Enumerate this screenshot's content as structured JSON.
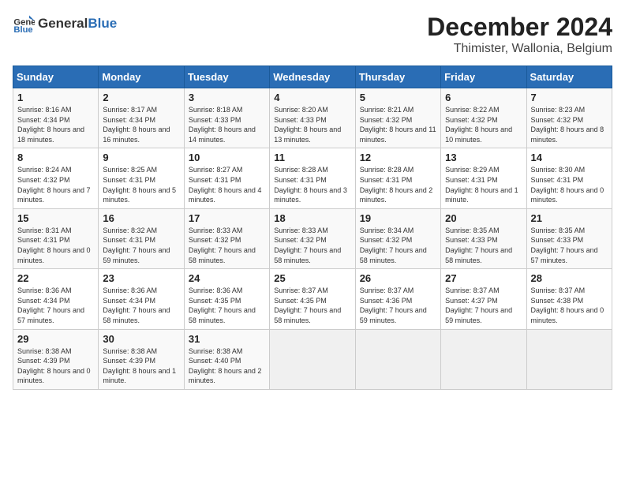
{
  "header": {
    "logo_general": "General",
    "logo_blue": "Blue",
    "title": "December 2024",
    "subtitle": "Thimister, Wallonia, Belgium"
  },
  "calendar": {
    "days_of_week": [
      "Sunday",
      "Monday",
      "Tuesday",
      "Wednesday",
      "Thursday",
      "Friday",
      "Saturday"
    ],
    "weeks": [
      [
        {
          "day": "",
          "info": ""
        },
        {
          "day": "2",
          "info": "Sunrise: 8:17 AM\nSunset: 4:34 PM\nDaylight: 8 hours and 16 minutes."
        },
        {
          "day": "3",
          "info": "Sunrise: 8:18 AM\nSunset: 4:33 PM\nDaylight: 8 hours and 14 minutes."
        },
        {
          "day": "4",
          "info": "Sunrise: 8:20 AM\nSunset: 4:33 PM\nDaylight: 8 hours and 13 minutes."
        },
        {
          "day": "5",
          "info": "Sunrise: 8:21 AM\nSunset: 4:32 PM\nDaylight: 8 hours and 11 minutes."
        },
        {
          "day": "6",
          "info": "Sunrise: 8:22 AM\nSunset: 4:32 PM\nDaylight: 8 hours and 10 minutes."
        },
        {
          "day": "7",
          "info": "Sunrise: 8:23 AM\nSunset: 4:32 PM\nDaylight: 8 hours and 8 minutes."
        }
      ],
      [
        {
          "day": "1",
          "info": "Sunrise: 8:16 AM\nSunset: 4:34 PM\nDaylight: 8 hours and 18 minutes."
        },
        {
          "day": "",
          "info": ""
        },
        {
          "day": "",
          "info": ""
        },
        {
          "day": "",
          "info": ""
        },
        {
          "day": "",
          "info": ""
        },
        {
          "day": "",
          "info": ""
        },
        {
          "day": "",
          "info": ""
        }
      ],
      [
        {
          "day": "8",
          "info": "Sunrise: 8:24 AM\nSunset: 4:32 PM\nDaylight: 8 hours and 7 minutes."
        },
        {
          "day": "9",
          "info": "Sunrise: 8:25 AM\nSunset: 4:31 PM\nDaylight: 8 hours and 5 minutes."
        },
        {
          "day": "10",
          "info": "Sunrise: 8:27 AM\nSunset: 4:31 PM\nDaylight: 8 hours and 4 minutes."
        },
        {
          "day": "11",
          "info": "Sunrise: 8:28 AM\nSunset: 4:31 PM\nDaylight: 8 hours and 3 minutes."
        },
        {
          "day": "12",
          "info": "Sunrise: 8:28 AM\nSunset: 4:31 PM\nDaylight: 8 hours and 2 minutes."
        },
        {
          "day": "13",
          "info": "Sunrise: 8:29 AM\nSunset: 4:31 PM\nDaylight: 8 hours and 1 minute."
        },
        {
          "day": "14",
          "info": "Sunrise: 8:30 AM\nSunset: 4:31 PM\nDaylight: 8 hours and 0 minutes."
        }
      ],
      [
        {
          "day": "15",
          "info": "Sunrise: 8:31 AM\nSunset: 4:31 PM\nDaylight: 8 hours and 0 minutes."
        },
        {
          "day": "16",
          "info": "Sunrise: 8:32 AM\nSunset: 4:31 PM\nDaylight: 7 hours and 59 minutes."
        },
        {
          "day": "17",
          "info": "Sunrise: 8:33 AM\nSunset: 4:32 PM\nDaylight: 7 hours and 58 minutes."
        },
        {
          "day": "18",
          "info": "Sunrise: 8:33 AM\nSunset: 4:32 PM\nDaylight: 7 hours and 58 minutes."
        },
        {
          "day": "19",
          "info": "Sunrise: 8:34 AM\nSunset: 4:32 PM\nDaylight: 7 hours and 58 minutes."
        },
        {
          "day": "20",
          "info": "Sunrise: 8:35 AM\nSunset: 4:33 PM\nDaylight: 7 hours and 58 minutes."
        },
        {
          "day": "21",
          "info": "Sunrise: 8:35 AM\nSunset: 4:33 PM\nDaylight: 7 hours and 57 minutes."
        }
      ],
      [
        {
          "day": "22",
          "info": "Sunrise: 8:36 AM\nSunset: 4:34 PM\nDaylight: 7 hours and 57 minutes."
        },
        {
          "day": "23",
          "info": "Sunrise: 8:36 AM\nSunset: 4:34 PM\nDaylight: 7 hours and 58 minutes."
        },
        {
          "day": "24",
          "info": "Sunrise: 8:36 AM\nSunset: 4:35 PM\nDaylight: 7 hours and 58 minutes."
        },
        {
          "day": "25",
          "info": "Sunrise: 8:37 AM\nSunset: 4:35 PM\nDaylight: 7 hours and 58 minutes."
        },
        {
          "day": "26",
          "info": "Sunrise: 8:37 AM\nSunset: 4:36 PM\nDaylight: 7 hours and 59 minutes."
        },
        {
          "day": "27",
          "info": "Sunrise: 8:37 AM\nSunset: 4:37 PM\nDaylight: 7 hours and 59 minutes."
        },
        {
          "day": "28",
          "info": "Sunrise: 8:37 AM\nSunset: 4:38 PM\nDaylight: 8 hours and 0 minutes."
        }
      ],
      [
        {
          "day": "29",
          "info": "Sunrise: 8:38 AM\nSunset: 4:39 PM\nDaylight: 8 hours and 0 minutes."
        },
        {
          "day": "30",
          "info": "Sunrise: 8:38 AM\nSunset: 4:39 PM\nDaylight: 8 hours and 1 minute."
        },
        {
          "day": "31",
          "info": "Sunrise: 8:38 AM\nSunset: 4:40 PM\nDaylight: 8 hours and 2 minutes."
        },
        {
          "day": "",
          "info": ""
        },
        {
          "day": "",
          "info": ""
        },
        {
          "day": "",
          "info": ""
        },
        {
          "day": "",
          "info": ""
        }
      ]
    ]
  }
}
